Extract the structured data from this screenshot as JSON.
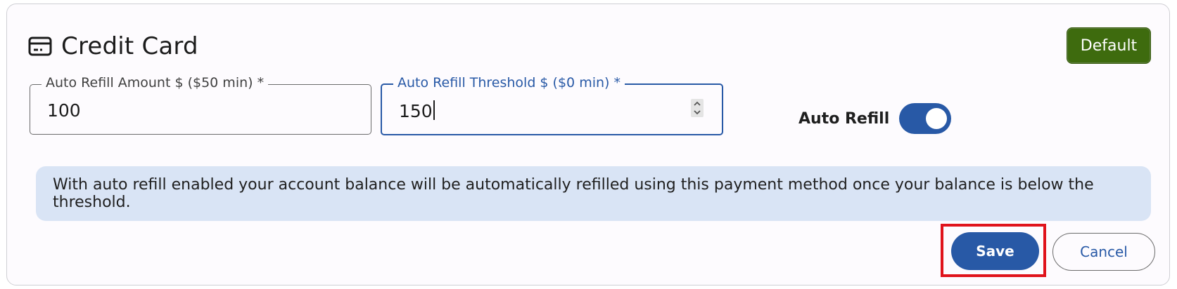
{
  "card": {
    "title": "Credit Card",
    "icon": "credit-card-icon",
    "badge": "Default",
    "badge_color": "#3e6b0e"
  },
  "fields": {
    "amount": {
      "label": "Auto Refill Amount $ ($50 min) *",
      "value": "100"
    },
    "threshold": {
      "label": "Auto Refill Threshold $ ($0 min) *",
      "value": "150"
    }
  },
  "toggle": {
    "label": "Auto Refill",
    "enabled": true
  },
  "info": {
    "text": "With auto refill enabled your account balance will be automatically refilled using this payment method once your balance is below the threshold."
  },
  "actions": {
    "save": "Save",
    "cancel": "Cancel"
  },
  "colors": {
    "primary": "#2859a6",
    "info_bg": "#d9e4f5",
    "highlight": "#e0131b"
  }
}
